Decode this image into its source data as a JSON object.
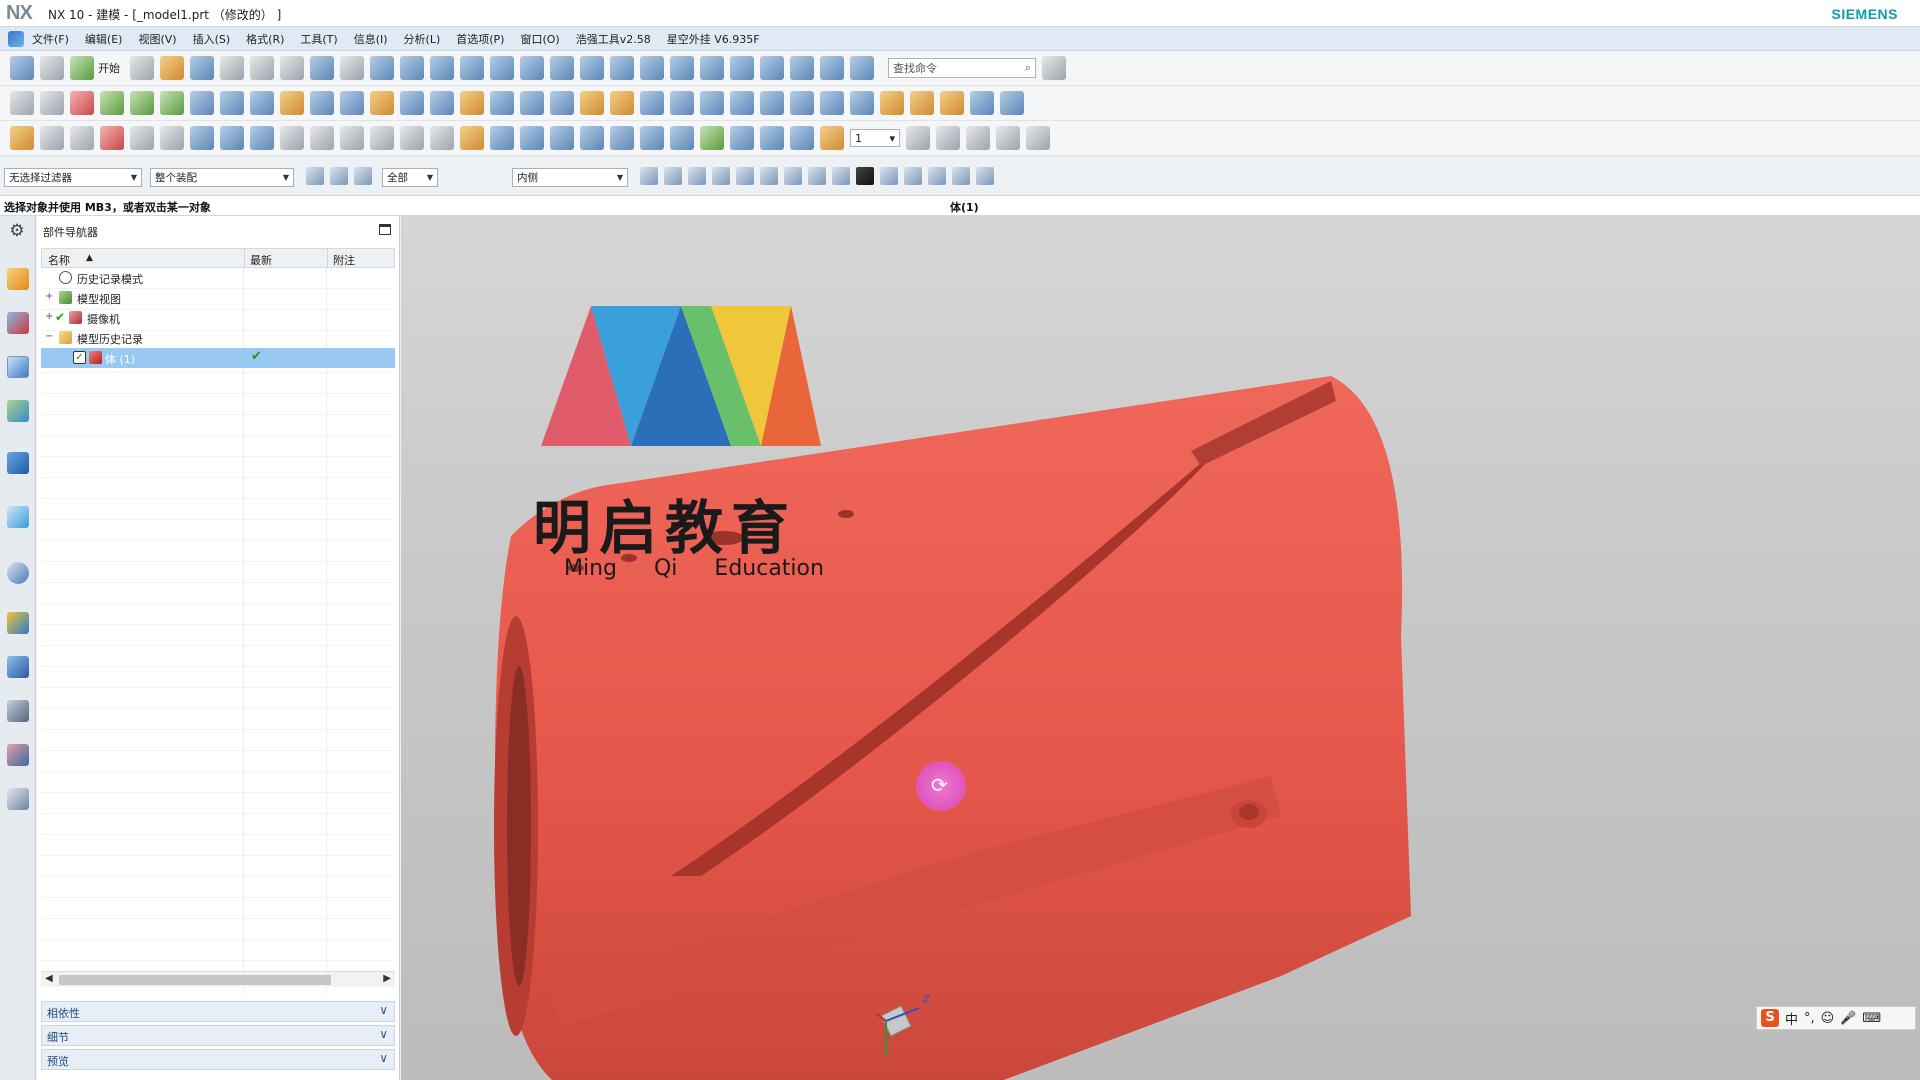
{
  "window": {
    "app_logo": "NX",
    "title": "NX 10 - 建模 - [_model1.prt （修改的） ]",
    "brand": "SIEMENS"
  },
  "menu": {
    "items": [
      "文件(F)",
      "编辑(E)",
      "视图(V)",
      "插入(S)",
      "格式(R)",
      "工具(T)",
      "信息(I)",
      "分析(L)",
      "首选项(P)",
      "窗口(O)",
      "浩强工具v2.58",
      "星空外挂 V6.935F"
    ]
  },
  "toolbar": {
    "start_label": "开始",
    "command_search_placeholder": "查找命令",
    "layer_value": "1"
  },
  "selection_bar": {
    "type_filter": "无选择过滤器",
    "scope": "整个装配",
    "extra_filter": "全部",
    "snap_mode": "内侧"
  },
  "status": {
    "message": "选择对象并使用 MB3，或者双击某一对象",
    "selected_object": "体(1)"
  },
  "navigator": {
    "title": "部件导航器",
    "columns": {
      "name": "名称",
      "latest": "最新",
      "note": "附注"
    },
    "rows": [
      {
        "label": "历史记录模式",
        "icon": "clock-icon",
        "expand": ""
      },
      {
        "label": "模型视图",
        "icon": "model-views-icon",
        "expand": "+"
      },
      {
        "label": "摄像机",
        "icon": "camera-icon",
        "expand": "+"
      },
      {
        "label": "模型历史记录",
        "icon": "folder-icon",
        "expand": "−"
      },
      {
        "label": "体 (1)",
        "icon": "body-feature-icon",
        "expand": "",
        "selected": true,
        "latest": "✔"
      }
    ],
    "panels": [
      "相依性",
      "细节",
      "预览"
    ]
  },
  "viewport": {
    "watermark_cn": "明启教育",
    "watermark_en": "Ming Qi Education",
    "triad_axis": "Z",
    "model_color": "#e8584a"
  },
  "ime": {
    "label": "中"
  }
}
